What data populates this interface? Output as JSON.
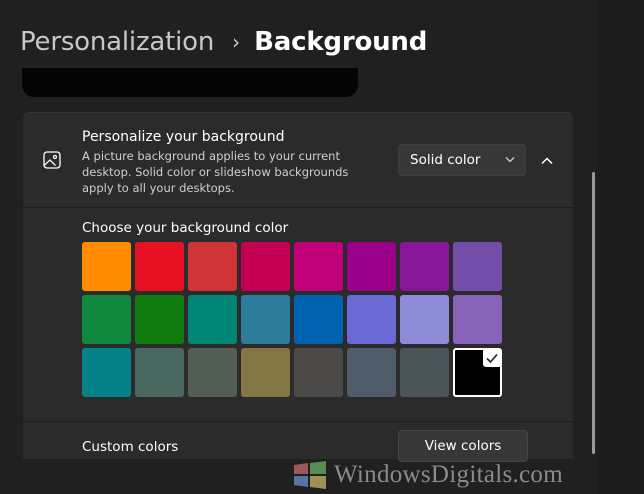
{
  "breadcrumb": {
    "parent": "Personalization",
    "separator": "›",
    "current": "Background"
  },
  "card": {
    "title": "Personalize your background",
    "description": "A picture background applies to your current desktop. Solid color or slideshow backgrounds apply to all your desktops.",
    "dropdown_value": "Solid color",
    "icon": "picture-icon",
    "collapse_icon": "chevron-up-icon"
  },
  "colors": {
    "label": "Choose your background color",
    "swatches": [
      "#ff8c00",
      "#e81123",
      "#d13438",
      "#c30052",
      "#bf0077",
      "#9a0089",
      "#881798",
      "#744da9",
      "#10893e",
      "#107c10",
      "#018574",
      "#2d7d9a",
      "#0063b1",
      "#6b69d6",
      "#8e8cd8",
      "#8764b8",
      "#038387",
      "#486860",
      "#525e54",
      "#847545",
      "#4c4a48",
      "#515c6b",
      "#4a5459",
      "#000000"
    ],
    "selected_index": 23,
    "check_icon": "checkmark-icon"
  },
  "custom": {
    "label": "Custom colors",
    "button": "View colors"
  },
  "watermark": {
    "text": "WindowsDigitals.com"
  }
}
